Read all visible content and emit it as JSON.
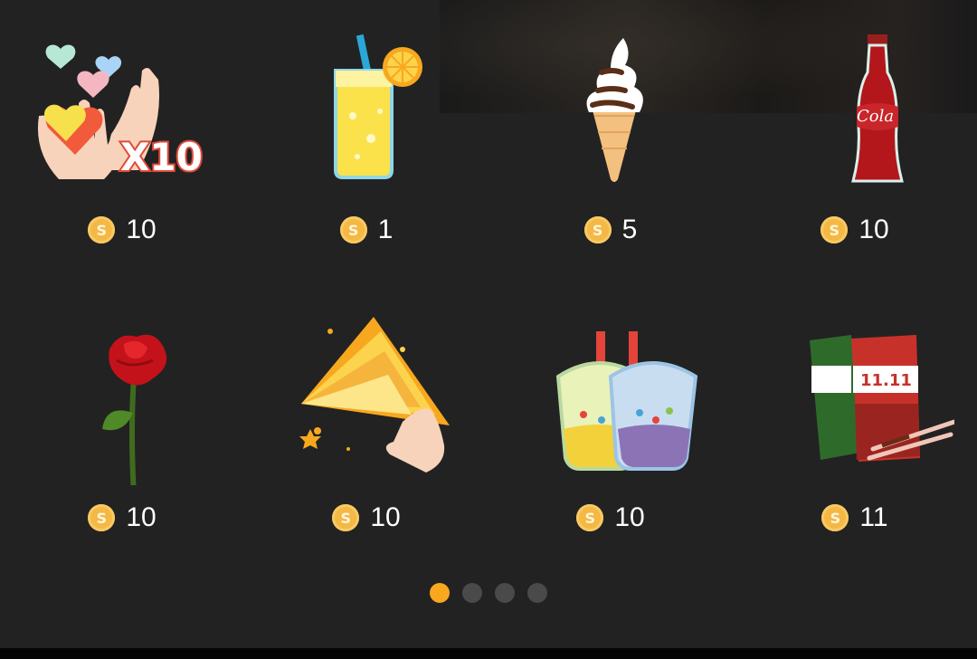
{
  "gifts": [
    {
      "name": "hearts-x10",
      "price": "10",
      "badge": "X10",
      "icon": "hands-hearts-icon"
    },
    {
      "name": "orange-juice",
      "price": "1",
      "icon": "juice-glass-icon"
    },
    {
      "name": "ice-cream",
      "price": "5",
      "icon": "ice-cream-cone-icon"
    },
    {
      "name": "cola",
      "price": "10",
      "label": "Cola",
      "icon": "cola-bottle-icon"
    },
    {
      "name": "rose",
      "price": "10",
      "icon": "rose-icon"
    },
    {
      "name": "confetti-hand",
      "price": "10",
      "icon": "confetti-hand-icon"
    },
    {
      "name": "bubble-tea",
      "price": "10",
      "icon": "bubble-tea-icon"
    },
    {
      "name": "pocky-1111",
      "price": "11",
      "label": "11.11",
      "icon": "pocky-box-icon"
    }
  ],
  "coin_symbol": "S",
  "pager": {
    "count": 4,
    "active": 0
  },
  "colors": {
    "background": "#222222",
    "coin": "#f4b844",
    "active_dot": "#f7a81f",
    "inactive_dot": "#4a4a4a"
  }
}
